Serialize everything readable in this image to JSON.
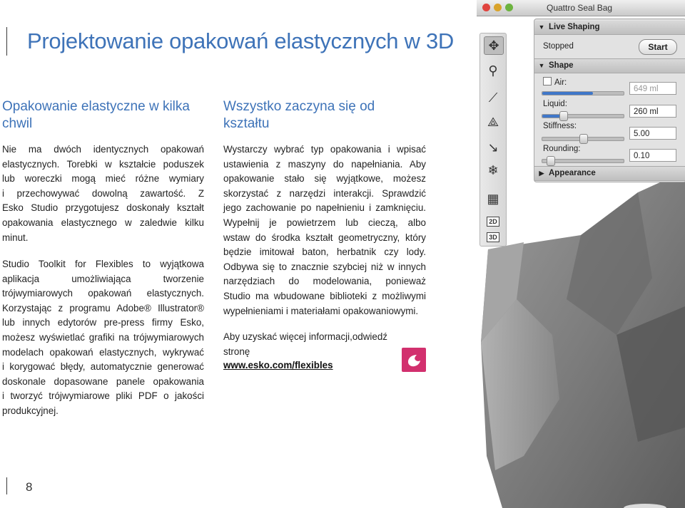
{
  "page": {
    "title": "Projektowanie opakowań elastycznych w 3D",
    "page_number": "8"
  },
  "left_column": {
    "heading_line1": "Opakowanie elastyczne w kilka",
    "heading_line2": "chwil",
    "p1": [
      "Nie ma dwóch identycznych opakowań",
      "elastycznych. Torebki w kształcie poduszek",
      "lub woreczki mogą mieć różne wymiary",
      "i przechowywać dowolną zawartość. Z",
      "Esko Studio przygotujesz doskonały kształt",
      "opakowania elastycznego w zaledwie kilku",
      "minut."
    ],
    "p2": [
      "Studio Toolkit for Flexibles to wyjątkowa",
      "aplikacja umożliwiająca tworzenie",
      "trójwymiarowych opakowań elastycznych.",
      "Korzystając z programu Adobe® Illustrator®",
      "lub innych edytorów pre-press firmy Esko,",
      "możesz wyświetlać grafiki na trójwymiarowych",
      "modelach opakowań elastycznych, wykrywać",
      "i korygować błędy, automatycznie generować",
      "doskonale dopasowane panele opakowania",
      "i tworzyć trójwymiarowe pliki PDF o jakości",
      "produkcyjnej."
    ]
  },
  "middle_column": {
    "heading_line1": "Wszystko zaczyna się od",
    "heading_line2": "kształtu",
    "p1": [
      "Wystarczy wybrać typ opakowania i wpisać",
      "ustawienia z maszyny do napełniania. Aby",
      "opakowanie stało się wyjątkowe, możesz",
      "skorzystać z narzędzi interakcji. Sprawdzić",
      "jego zachowanie po napełnieniu i zamknięciu.",
      "Wypełnij je powietrzem lub cieczą, albo",
      "wstaw do środka kształt geometryczny, który",
      "będzie imitował baton, herbatnik czy lody.",
      "Odbywa się to znacznie szybciej niż w innych",
      "narzędziach do modelowania, ponieważ",
      "Studio ma wbudowane biblioteki z możliwymi",
      "wypełnieniami i materiałami opakowaniowymi."
    ],
    "p2": [
      "Aby uzyskać więcej informacji,",
      "odwiedź stronę"
    ],
    "link": "www.esko.com/flexibles"
  },
  "app": {
    "window_title": "Quattro Seal Bag",
    "live_shaping_header": "Live Shaping",
    "status": "Stopped",
    "start_button": "Start",
    "shape_header": "Shape",
    "air_label": "Air:",
    "air_value": "649 ml",
    "liquid_label": "Liquid:",
    "liquid_value": "260 ml",
    "stiffness_label": "Stiffness:",
    "stiffness_value": "5.00",
    "rounding_label": "Rounding:",
    "rounding_value": "0.10",
    "appearance_header": "Appearance",
    "tool_2d": "2D",
    "tool_3d": "3D",
    "sliders": {
      "air": 0.62,
      "liquid": 0.25,
      "stiffness": 0.5,
      "rounding": 0.1
    }
  },
  "colors": {
    "accent": "#3e73b8",
    "brand_pink": "#d2306e"
  }
}
